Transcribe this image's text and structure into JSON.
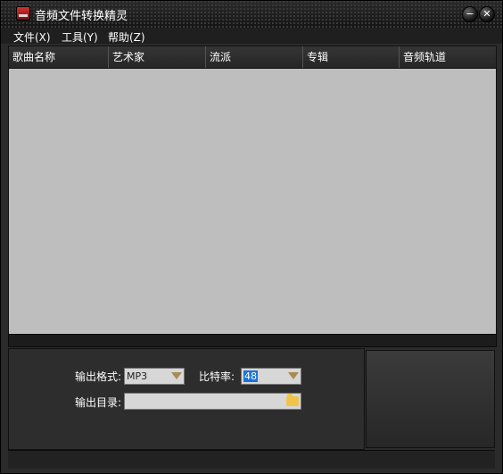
{
  "app": {
    "title": "音頻文件转换精灵"
  },
  "menu": [
    {
      "label": "文件(X)"
    },
    {
      "label": "工具(Y)"
    },
    {
      "label": "帮助(Z)"
    }
  ],
  "list": {
    "columns": [
      "歌曲名称",
      "艺术家",
      "流派",
      "专辑",
      "音频轨道"
    ],
    "rows": []
  },
  "settings": {
    "format_label": "输出格式:",
    "format_value": "MP3",
    "bitrate_label": "比特率:",
    "bitrate_value": "48",
    "dir_label": "输出目录:",
    "dir_value": ""
  },
  "icons": {
    "app": "audio-app-icon",
    "minimize": "minimize-icon",
    "close": "close-icon",
    "dropdown": "chevron-down-icon",
    "folder": "folder-icon"
  },
  "colors": {
    "background": "#2b2b2b",
    "list_background": "#bebebe",
    "selection": "#1b74d6",
    "arrow": "#a78b52",
    "folder": "#f0c34a"
  }
}
